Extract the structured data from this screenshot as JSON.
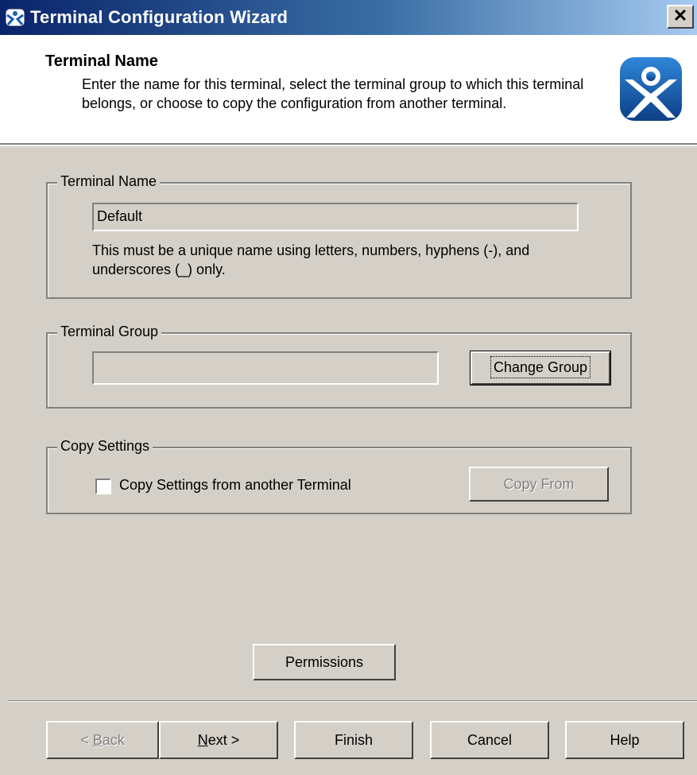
{
  "window": {
    "title": "Terminal Configuration Wizard",
    "close_label": "✕",
    "title_icon": "thinmanager-icon"
  },
  "header": {
    "title": "Terminal Name",
    "description": "Enter the name for this terminal, select the terminal group to which this terminal belongs, or choose to copy the configuration from another terminal.",
    "logo": "thinmanager-logo",
    "brand_color": "#1a5fb4"
  },
  "terminal_name": {
    "group_label": "Terminal Name",
    "value": "Default",
    "hint": "This must be a unique name using letters, numbers, hyphens (-), and underscores (_) only."
  },
  "terminal_group": {
    "group_label": "Terminal Group",
    "value": "",
    "change_button": "Change Group"
  },
  "copy_settings": {
    "group_label": "Copy Settings",
    "checkbox_label": "Copy Settings from another Terminal",
    "checked": false,
    "copy_button": "Copy From"
  },
  "permissions_button": "Permissions",
  "footer": {
    "back_prefix": "< ",
    "back_mnemonic": "B",
    "back_rest": "ack",
    "next_mnemonic": "N",
    "next_rest": "ext >",
    "finish": "Finish",
    "cancel": "Cancel",
    "help": "Help"
  }
}
